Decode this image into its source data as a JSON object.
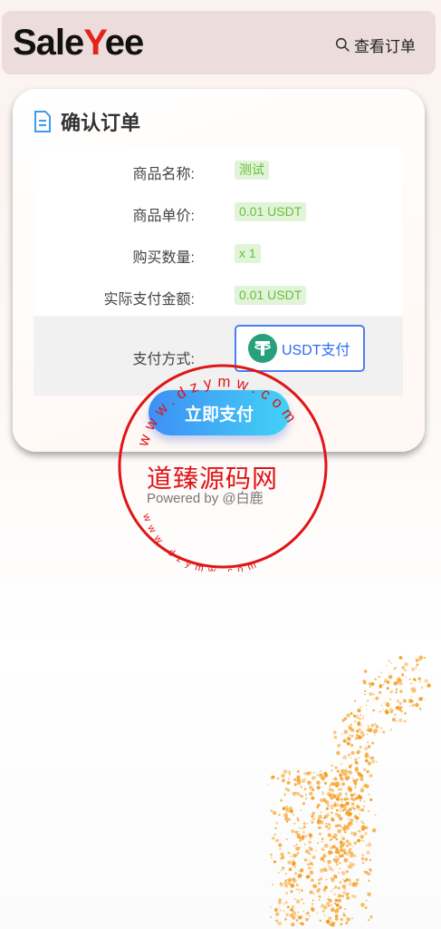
{
  "header": {
    "logo_prefix": "Sale",
    "logo_y": "Y",
    "logo_suffix": "ee",
    "view_order": "查看订单"
  },
  "card": {
    "title": "确认订单",
    "rows": [
      {
        "label": "商品名称:",
        "value": "测试"
      },
      {
        "label": "商品单价:",
        "value": "0.01 USDT"
      },
      {
        "label": "购买数量:",
        "value": "x 1"
      },
      {
        "label": "实际支付金额:",
        "value": "0.01 USDT"
      }
    ],
    "payment_label": "支付方式:",
    "payment_option": "USDT支付",
    "pay_button": "立即支付"
  },
  "footer": {
    "powered_by": "Powered by @白鹿"
  },
  "watermark": {
    "text": "道臻源码网",
    "url_top": "www.dzymw.com",
    "url_bottom": "www.dzymw.com"
  },
  "colors": {
    "accent": "#3d8ff5",
    "tag_bg": "#e1f3d8",
    "tag_text": "#67c23a",
    "stamp": "#e01515",
    "tether": "#26a17b"
  }
}
